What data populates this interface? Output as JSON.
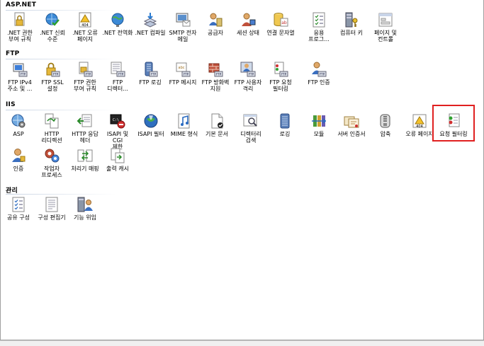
{
  "groups": [
    {
      "title": "ASP.NET",
      "items": [
        {
          "label": ".NET 권한\n부여 규칙",
          "icon": "lock-document-icon"
        },
        {
          "label": ".NET 신뢰\n수준",
          "icon": "globe-check-icon"
        },
        {
          "label": ".NET 오류\n페이지",
          "icon": "error-page-404-icon"
        },
        {
          "label": ".NET 전역화",
          "icon": "globe-icon"
        },
        {
          "label": ".NET 컴파일",
          "icon": "compile-download-icon"
        },
        {
          "label": "SMTP 전자\n메일",
          "icon": "mail-monitor-icon"
        },
        {
          "label": "공급자",
          "icon": "provider-users-icon"
        },
        {
          "label": "세션 상태",
          "icon": "session-user-icon"
        },
        {
          "label": "연결 문자열",
          "icon": "database-ab-icon"
        },
        {
          "label": "응용\n프로그...",
          "icon": "checklist-icon"
        },
        {
          "label": "컴퓨터 키",
          "icon": "server-key-icon"
        },
        {
          "label": "페이지 및\n컨트롤",
          "icon": "page-controls-icon"
        }
      ]
    },
    {
      "title": "FTP",
      "items": [
        {
          "label": "FTP IPv4\n주소 및 ...",
          "icon": "ftp-ipv4-icon"
        },
        {
          "label": "FTP SSL\n설정",
          "icon": "ftp-lock-icon"
        },
        {
          "label": "FTP 권한\n부여 규칙",
          "icon": "ftp-authorization-icon"
        },
        {
          "label": "FTP\n디렉터...",
          "icon": "ftp-directory-icon"
        },
        {
          "label": "FTP 로깅",
          "icon": "ftp-logging-icon"
        },
        {
          "label": "FTP 메시지",
          "icon": "ftp-message-icon"
        },
        {
          "label": "FTP 방화벽\n지원",
          "icon": "ftp-firewall-icon"
        },
        {
          "label": "FTP 사용자\n격리",
          "icon": "ftp-user-isolation-icon"
        },
        {
          "label": "FTP 요청\n필터링",
          "icon": "ftp-request-filter-icon"
        },
        {
          "label": "FTP 인증",
          "icon": "ftp-authentication-icon"
        }
      ]
    },
    {
      "title": "IIS",
      "items": [
        {
          "label": "ASP",
          "icon": "asp-gear-icon"
        },
        {
          "label": "HTTP\n리디렉션",
          "icon": "http-redirect-icon"
        },
        {
          "label": "HTTP 응답\n헤더",
          "icon": "http-response-headers-icon"
        },
        {
          "label": "ISAPI 및 CGI\n제한",
          "icon": "isapi-cgi-icon"
        },
        {
          "label": "ISAPI 필터",
          "icon": "isapi-filter-icon"
        },
        {
          "label": "MIME 형식",
          "icon": "mime-music-icon"
        },
        {
          "label": "기본 문서",
          "icon": "default-document-icon"
        },
        {
          "label": "디렉터리\n검색",
          "icon": "directory-browse-icon"
        },
        {
          "label": "로깅",
          "icon": "logging-icon"
        },
        {
          "label": "모듈",
          "icon": "modules-icon"
        },
        {
          "label": "서버 인증서",
          "icon": "server-certificate-icon"
        },
        {
          "label": "압축",
          "icon": "compression-icon"
        },
        {
          "label": "오류 페이지",
          "icon": "error-pages-icon"
        },
        {
          "label": "요청 필터링",
          "icon": "request-filtering-icon"
        },
        {
          "label": "인증",
          "icon": "authentication-icon"
        },
        {
          "label": "작업자\n프로세스",
          "icon": "worker-process-icon"
        },
        {
          "label": "처리기 매핑",
          "icon": "handler-mappings-icon"
        },
        {
          "label": "출력 캐시",
          "icon": "output-cache-icon"
        }
      ]
    },
    {
      "title": "관리",
      "items": [
        {
          "label": "공유 구성",
          "icon": "shared-config-icon"
        },
        {
          "label": "구성 편집기",
          "icon": "config-editor-icon"
        },
        {
          "label": "기능 위임",
          "icon": "feature-delegation-icon"
        }
      ]
    }
  ],
  "selected": "요청 필터링"
}
